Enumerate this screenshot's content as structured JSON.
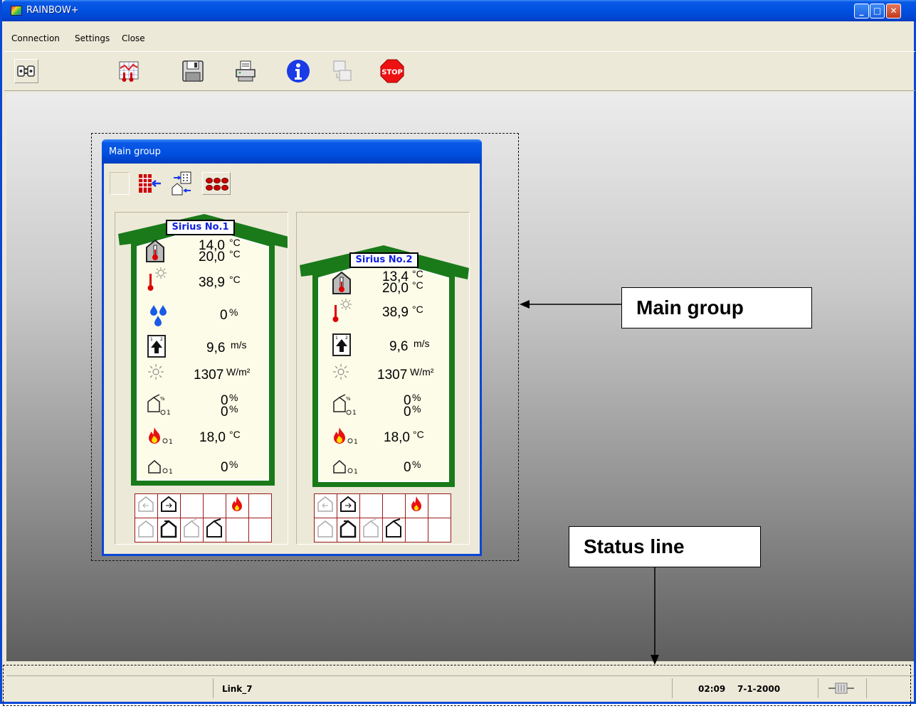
{
  "app": {
    "title": "RAINBOW+"
  },
  "menu": {
    "connection": "Connection",
    "settings": "Settings",
    "close": "Close"
  },
  "toolbar": {
    "icons": [
      "connection-icon",
      "graph-icon",
      "save-icon",
      "print-icon",
      "info-icon",
      "transfer-icon",
      "stop-icon"
    ],
    "stop_label": "STOP"
  },
  "group": {
    "title": "Main group",
    "tool_icons": [
      "blank-icon",
      "grid-arrow-icon",
      "building-transfer-icon",
      "sensor-array-icon"
    ]
  },
  "houses": [
    {
      "name": "Sirius No.1",
      "temp_in": "14,0",
      "temp_set": "20,0",
      "temp_unit": "°C",
      "temp_out": "38,9",
      "temp_out_unit": "°C",
      "humidity": "0",
      "humidity_unit": "%",
      "wind": "9,6",
      "wind_unit": "m/s",
      "radiation": "1307",
      "radiation_unit": "W/m²",
      "vent1": "0",
      "vent2": "0",
      "vent_unit": "%",
      "heating": "18,0",
      "heating_unit": "°C",
      "screen": "0",
      "screen_unit": "%"
    },
    {
      "name": "Sirius No.2",
      "temp_in": "13,4",
      "temp_set": "20,0",
      "temp_unit": "°C",
      "temp_out": "38,9",
      "temp_out_unit": "°C",
      "humidity": "",
      "humidity_unit": "",
      "wind": "9,6",
      "wind_unit": "m/s",
      "radiation": "1307",
      "radiation_unit": "W/m²",
      "vent1": "0",
      "vent2": "0",
      "vent_unit": "%",
      "heating": "18,0",
      "heating_unit": "°C",
      "screen": "0",
      "screen_unit": "%"
    }
  ],
  "status": {
    "link": "Link_7",
    "time": "02:09",
    "date": "7-1-2000"
  },
  "annotations": {
    "main_group": "Main group",
    "status_line": "Status line"
  },
  "colors": {
    "title_blue": "#0050e0",
    "house_green": "#1a7a1a",
    "grid_red": "#9a1a1a",
    "tag_blue": "#1020e0"
  }
}
